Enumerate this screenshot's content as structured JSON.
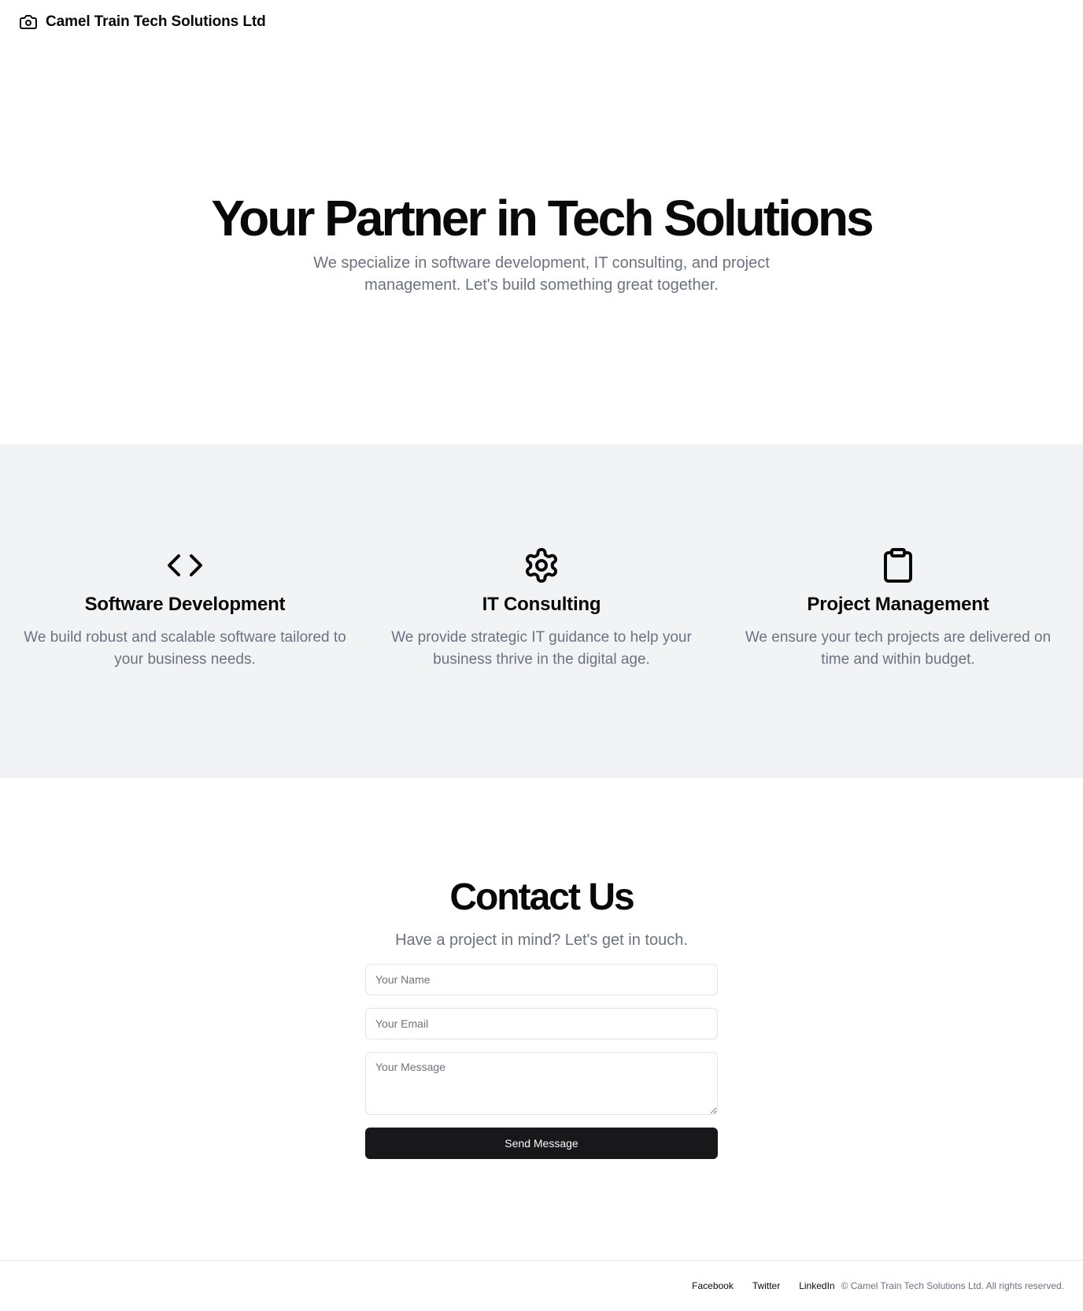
{
  "header": {
    "brand_icon": "camera-icon",
    "brand_name": "Camel Train Tech Solutions Ltd"
  },
  "hero": {
    "title": "Your Partner in Tech Solutions",
    "subtitle": "We specialize in software development, IT consulting, and project management. Let's build something great together."
  },
  "services": [
    {
      "icon": "code-icon",
      "title": "Software Development",
      "description": "We build robust and scalable software tailored to your business needs."
    },
    {
      "icon": "gear-icon",
      "title": "IT Consulting",
      "description": "We provide strategic IT guidance to help your business thrive in the digital age."
    },
    {
      "icon": "clipboard-icon",
      "title": "Project Management",
      "description": "We ensure your tech projects are delivered on time and within budget."
    }
  ],
  "contact": {
    "title": "Contact Us",
    "subtitle": "Have a project in mind? Let's get in touch.",
    "name_placeholder": "Your Name",
    "email_placeholder": "Your Email",
    "message_placeholder": "Your Message",
    "submit_label": "Send Message"
  },
  "footer": {
    "links": [
      "Facebook",
      "Twitter",
      "LinkedIn"
    ],
    "copyright": "© Camel Train Tech Solutions Ltd. All rights reserved."
  },
  "colors": {
    "text": "#09090b",
    "muted": "#6b7280",
    "section_bg": "#f2f3f5",
    "button_bg": "#18181b",
    "border": "#e4e4e7"
  }
}
